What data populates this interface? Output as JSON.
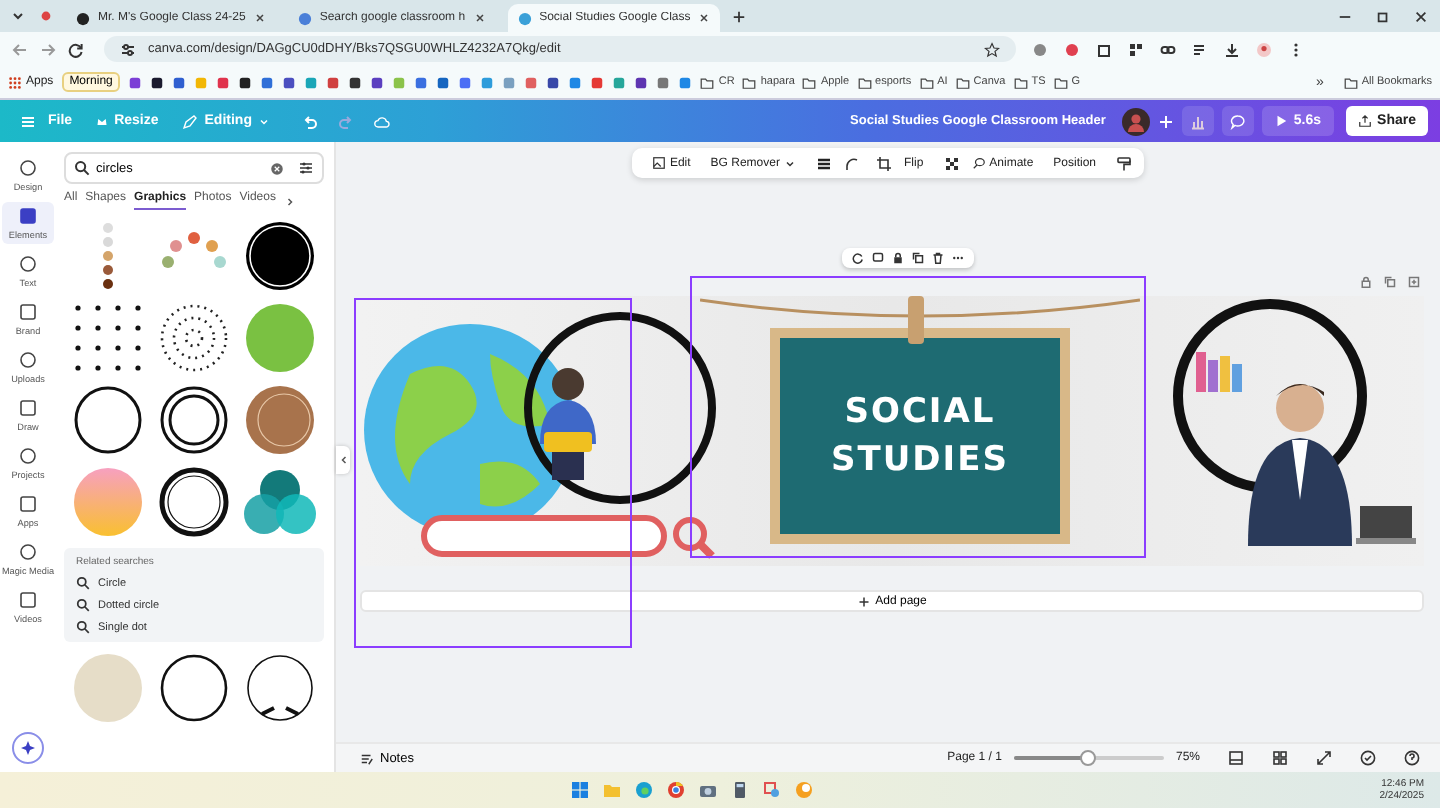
{
  "browser": {
    "tabs": [
      {
        "title": "Mr. M's Google Class 24-25",
        "selected": false
      },
      {
        "title": "Search google classroom h",
        "selected": false
      },
      {
        "title": "Social Studies Google Class",
        "selected": true
      }
    ],
    "url": "canva.com/design/DAGgCU0dDHY/Bks7QSGU0WHLZ4232A7Qkg/edit",
    "bookmarks": {
      "apps": "Apps",
      "chip": "Morning",
      "folders": [
        "CR",
        "hapara",
        "Apple",
        "esports",
        "AI",
        "Canva",
        "TS",
        "G"
      ],
      "overflow": "»",
      "all": "All Bookmarks"
    }
  },
  "header": {
    "menu": [
      "File",
      "Resize"
    ],
    "mode": "Editing",
    "title": "Social Studies Google Classroom Header",
    "timer": "5.6s",
    "share": "Share"
  },
  "rail": [
    {
      "label": "Design",
      "selected": false
    },
    {
      "label": "Elements",
      "selected": true
    },
    {
      "label": "Text",
      "selected": false
    },
    {
      "label": "Brand",
      "selected": false
    },
    {
      "label": "Uploads",
      "selected": false
    },
    {
      "label": "Draw",
      "selected": false
    },
    {
      "label": "Projects",
      "selected": false
    },
    {
      "label": "Apps",
      "selected": false
    },
    {
      "label": "Magic Media",
      "selected": false
    },
    {
      "label": "Videos",
      "selected": false
    }
  ],
  "panel": {
    "search": "circles",
    "tabs": [
      {
        "label": "All",
        "selected": false
      },
      {
        "label": "Shapes",
        "selected": false
      },
      {
        "label": "Graphics",
        "selected": true
      },
      {
        "label": "Photos",
        "selected": false
      },
      {
        "label": "Videos",
        "selected": false
      }
    ],
    "related_title": "Related searches",
    "related": [
      "Circle",
      "Dotted circle",
      "Single dot"
    ]
  },
  "toolbar": [
    "Edit",
    "BG Remover",
    "Flip",
    "Animate",
    "Position"
  ],
  "design": {
    "board_lines": [
      "SOCIAL",
      "STUDIES"
    ],
    "add_page": "Add page"
  },
  "footer": {
    "notes": "Notes",
    "page": "Page 1 / 1",
    "zoom": {
      "level": 0.5
    },
    "zoom_text": "75%"
  },
  "taskbar": {
    "time": "12:46 PM",
    "date": "2/24/2025"
  }
}
